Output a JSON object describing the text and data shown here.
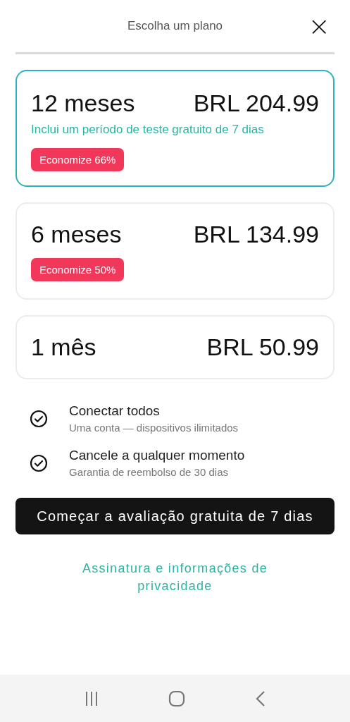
{
  "header": {
    "title": "Escolha um plano",
    "close": "×"
  },
  "plans": [
    {
      "duration": "12 meses",
      "price": "BRL 204.99",
      "note": "Inclui um período de teste gratuito de 7 dias",
      "badge": "Economize 66%",
      "selected": true
    },
    {
      "duration": "6 meses",
      "price": "BRL 134.99",
      "badge": "Economize 50%",
      "selected": false
    },
    {
      "duration": "1 mês",
      "price": "BRL 50.99",
      "selected": false
    }
  ],
  "features": [
    {
      "title": "Conectar todos",
      "subtitle": "Uma conta — dispositivos ilimitados"
    },
    {
      "title": "Cancele a qualquer momento",
      "subtitle": "Garantia de reembolso de 30 dias"
    }
  ],
  "cta": {
    "label": "Começar a avaliação gratuita de 7 dias"
  },
  "link": {
    "label": "Assinatura e informações de privacidade"
  }
}
